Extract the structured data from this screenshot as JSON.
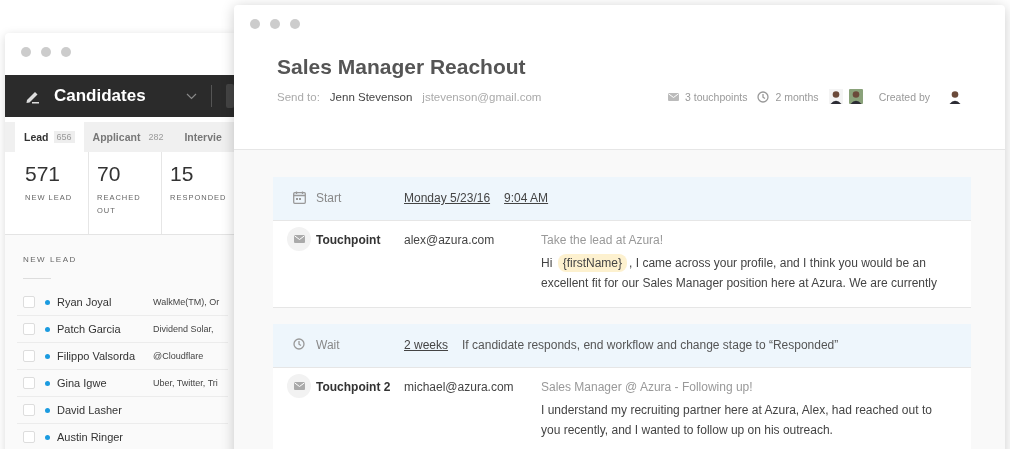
{
  "candidates_window": {
    "title": "Candidates",
    "tabs": [
      {
        "label": "Lead",
        "count": "656",
        "selected": true
      },
      {
        "label": "Applicant",
        "count": "282",
        "selected": false
      },
      {
        "label": "Intervie",
        "selected": false
      }
    ],
    "stats": [
      {
        "value": "571",
        "label": "NEW LEAD"
      },
      {
        "value": "70",
        "label": "REACHED OUT"
      },
      {
        "value": "15",
        "label": "RESPONDED"
      }
    ],
    "section_title": "NEW LEAD",
    "rows": [
      {
        "name": "Ryan Joyal",
        "company": "WalkMe(TM), Or",
        "checked": false
      },
      {
        "name": "Patch Garcia",
        "company": "Dividend Solar,",
        "checked": false
      },
      {
        "name": "Filippo Valsorda",
        "company": "@Cloudflare",
        "checked": false
      },
      {
        "name": "Gina Igwe",
        "company": "Uber, Twitter, Tri",
        "checked": false
      },
      {
        "name": "David Lasher",
        "checked": false
      },
      {
        "name": "Austin Ringer",
        "checked": false
      }
    ]
  },
  "sequence_window": {
    "title": "Sales Manager Reachout",
    "send_to_label": "Send to:",
    "recipient_name": "Jenn Stevenson",
    "recipient_email": "jstevenson@gmail.com",
    "touchpoints": "3 touchpoints",
    "duration": "2 months",
    "created_by_label": "Created by",
    "steps": [
      {
        "kind": "start",
        "label": "Start",
        "date": "Monday 5/23/16",
        "time": "9:04 AM"
      },
      {
        "kind": "touchpoint",
        "label": "Touchpoint",
        "sender": "alex@azura.com",
        "subject": "Take the lead at Azura!",
        "greeting": "Hi",
        "token": "{firstName}",
        "body": ", I came across your profile, and I think you would be an excellent fit for our Sales Manager position here at Azura. We are currently"
      },
      {
        "kind": "wait",
        "label": "Wait",
        "duration": "2 weeks",
        "note": "If candidate responds, end workflow and change stage to “Responded”"
      },
      {
        "kind": "touchpoint",
        "label": "Touchpoint 2",
        "sender": "michael@azura.com",
        "subject": "Sales Manager @ Azura - Following up!",
        "body": "I understand my recruiting partner here at Azura, Alex, had reached out to you recently, and I wanted to follow up on his outreach."
      }
    ]
  }
}
